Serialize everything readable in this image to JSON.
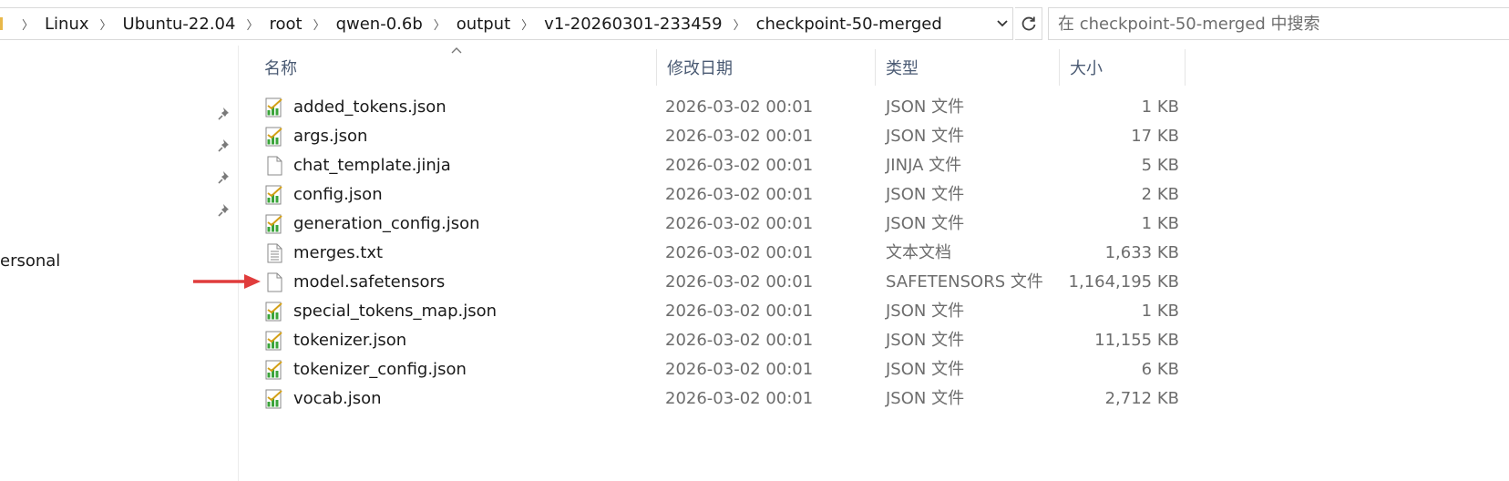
{
  "address_bar": {
    "breadcrumbs": [
      "Linux",
      "Ubuntu-22.04",
      "root",
      "qwen-0.6b",
      "output",
      "v1-20260301-233459",
      "checkpoint-50-merged"
    ],
    "dropdown_icon": "chevron-down-icon",
    "refresh_icon": "refresh-icon"
  },
  "search": {
    "placeholder": "在 checkpoint-50-merged 中搜索"
  },
  "nav": {
    "visible_label": "ersonal",
    "pin_icon": "pin-icon"
  },
  "columns": {
    "name": "名称",
    "date": "修改日期",
    "type": "类型",
    "size": "大小"
  },
  "files": [
    {
      "name": "added_tokens.json",
      "date": "2026-03-02 00:01",
      "type": "JSON 文件",
      "size": "1 KB",
      "icon": "json-file-icon"
    },
    {
      "name": "args.json",
      "date": "2026-03-02 00:01",
      "type": "JSON 文件",
      "size": "17 KB",
      "icon": "json-file-icon"
    },
    {
      "name": "chat_template.jinja",
      "date": "2026-03-02 00:01",
      "type": "JINJA 文件",
      "size": "5 KB",
      "icon": "blank-file-icon"
    },
    {
      "name": "config.json",
      "date": "2026-03-02 00:01",
      "type": "JSON 文件",
      "size": "2 KB",
      "icon": "json-file-icon"
    },
    {
      "name": "generation_config.json",
      "date": "2026-03-02 00:01",
      "type": "JSON 文件",
      "size": "1 KB",
      "icon": "json-file-icon"
    },
    {
      "name": "merges.txt",
      "date": "2026-03-02 00:01",
      "type": "文本文档",
      "size": "1,633 KB",
      "icon": "text-file-icon"
    },
    {
      "name": "model.safetensors",
      "date": "2026-03-02 00:01",
      "type": "SAFETENSORS 文件",
      "size": "1,164,195 KB",
      "icon": "blank-file-icon"
    },
    {
      "name": "special_tokens_map.json",
      "date": "2026-03-02 00:01",
      "type": "JSON 文件",
      "size": "1 KB",
      "icon": "json-file-icon"
    },
    {
      "name": "tokenizer.json",
      "date": "2026-03-02 00:01",
      "type": "JSON 文件",
      "size": "11,155 KB",
      "icon": "json-file-icon"
    },
    {
      "name": "tokenizer_config.json",
      "date": "2026-03-02 00:01",
      "type": "JSON 文件",
      "size": "6 KB",
      "icon": "json-file-icon"
    },
    {
      "name": "vocab.json",
      "date": "2026-03-02 00:01",
      "type": "JSON 文件",
      "size": "2,712 KB",
      "icon": "json-file-icon"
    }
  ],
  "annotation": {
    "arrow_color": "#e03c3c",
    "arrow_icon": "red-arrow-icon"
  }
}
